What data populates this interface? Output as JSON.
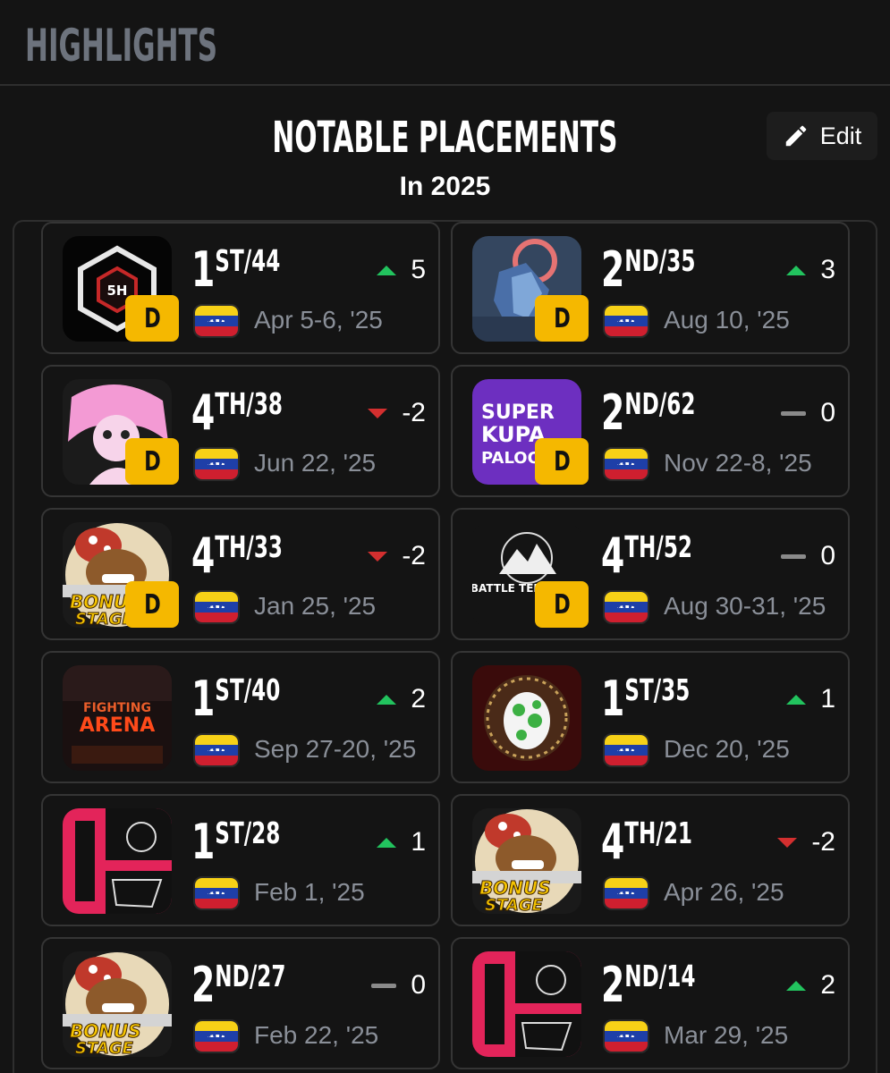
{
  "header": {
    "title": "HIGHLIGHTS"
  },
  "section": {
    "title": "NOTABLE PLACEMENTS",
    "subtitle": "In 2025",
    "edit_label": "Edit"
  },
  "colors": {
    "up": "#22c35e",
    "down": "#d32f2f",
    "neutral": "#8a8a8a",
    "badge": "#f5b800"
  },
  "placements": [
    {
      "num": "1",
      "suffix": "ST",
      "total": "/44",
      "trend": "up",
      "change": "5",
      "date": "Apr 5-6, '25",
      "badge": "D",
      "icon": "hexagon-logo-icon",
      "country": "venezuela-flag-icon"
    },
    {
      "num": "2",
      "suffix": "ND",
      "total": "/35",
      "trend": "up",
      "change": "3",
      "date": "Aug 10, '25",
      "badge": "D",
      "icon": "character-art-icon",
      "country": "venezuela-flag-icon"
    },
    {
      "num": "4",
      "suffix": "TH",
      "total": "/38",
      "trend": "down",
      "change": "-2",
      "date": "Jun 22, '25",
      "badge": "D",
      "icon": "anime-art-icon",
      "country": "venezuela-flag-icon"
    },
    {
      "num": "2",
      "suffix": "ND",
      "total": "/62",
      "trend": "neutral",
      "change": "0",
      "date": "Nov 22-8, '25",
      "badge": "D",
      "icon": "super-kupa-palooza-logo-icon",
      "country": "venezuela-flag-icon"
    },
    {
      "num": "4",
      "suffix": "TH",
      "total": "/33",
      "trend": "down",
      "change": "-2",
      "date": "Jan 25, '25",
      "badge": "D",
      "icon": "bonus-stage-logo-icon",
      "country": "venezuela-flag-icon"
    },
    {
      "num": "4",
      "suffix": "TH",
      "total": "/52",
      "trend": "neutral",
      "change": "0",
      "date": "Aug 30-31, '25",
      "badge": "D",
      "icon": "battle-tendency-logo-icon",
      "country": "venezuela-flag-icon"
    },
    {
      "num": "1",
      "suffix": "ST",
      "total": "/40",
      "trend": "up",
      "change": "2",
      "date": "Sep 27-20, '25",
      "badge": "",
      "icon": "fighting-arena-logo-icon",
      "country": "venezuela-flag-icon"
    },
    {
      "num": "1",
      "suffix": "ST",
      "total": "/35",
      "trend": "up",
      "change": "1",
      "date": "Dec 20, '25",
      "badge": "",
      "icon": "yoshi-egg-icon",
      "country": "venezuela-flag-icon"
    },
    {
      "num": "1",
      "suffix": "ST",
      "total": "/28",
      "trend": "up",
      "change": "1",
      "date": "Feb 1, '25",
      "badge": "",
      "icon": "smash-logo-icon",
      "country": "venezuela-flag-icon"
    },
    {
      "num": "4",
      "suffix": "TH",
      "total": "/21",
      "trend": "down",
      "change": "-2",
      "date": "Apr 26, '25",
      "badge": "",
      "icon": "bonus-stage-logo-icon",
      "country": "venezuela-flag-icon"
    },
    {
      "num": "2",
      "suffix": "ND",
      "total": "/27",
      "trend": "neutral",
      "change": "0",
      "date": "Feb 22, '25",
      "badge": "",
      "icon": "bonus-stage-logo-icon",
      "country": "venezuela-flag-icon"
    },
    {
      "num": "2",
      "suffix": "ND",
      "total": "/14",
      "trend": "up",
      "change": "2",
      "date": "Mar 29, '25",
      "badge": "",
      "icon": "smash-logo-icon",
      "country": "venezuela-flag-icon"
    }
  ],
  "thumb_text": {
    "hex": "5H",
    "kupa": [
      "SUPER",
      "KUPA",
      "PALOO"
    ],
    "bonus": [
      "BONUS",
      "STAGE"
    ],
    "battle": "BATTLE TENDENCY",
    "arena": [
      "FIGHTING",
      "ARENA"
    ]
  }
}
